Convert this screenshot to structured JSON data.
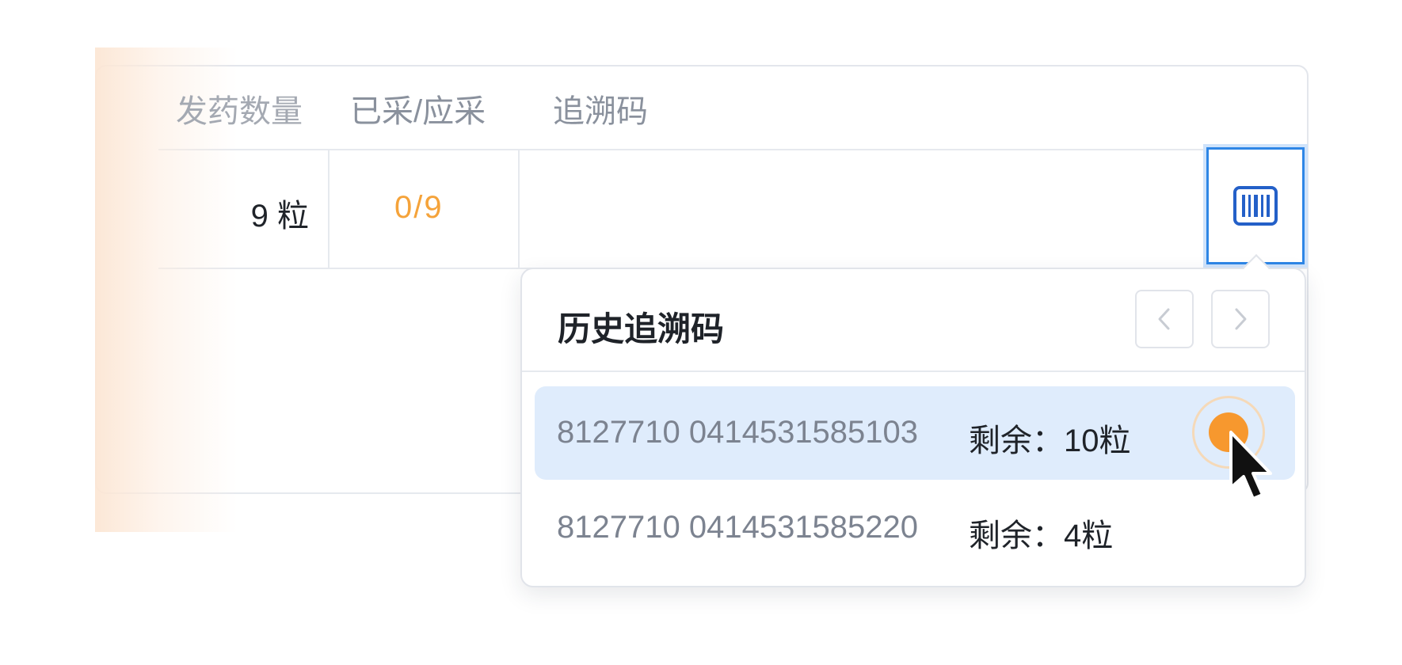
{
  "table": {
    "headers": {
      "qty": "发药数量",
      "ratio": "已采/应采",
      "trace": "追溯码"
    },
    "row": {
      "qty": "9 粒",
      "ratio": "0/9"
    },
    "scan_icon": "barcode-icon"
  },
  "popover": {
    "title": "历史追溯码",
    "prev_icon": "chevron-left-icon",
    "next_icon": "chevron-right-icon",
    "items": [
      {
        "code": "8127710 0414531585103",
        "remaining": "剩余：10粒",
        "selected": true
      },
      {
        "code": "8127710 0414531585220",
        "remaining": "剩余：4粒",
        "selected": false
      }
    ]
  },
  "colors": {
    "accent_blue": "#2e86e6",
    "selected_row": "#dfecfc",
    "orange": "#f7982e",
    "muted_text": "#8a919d"
  }
}
